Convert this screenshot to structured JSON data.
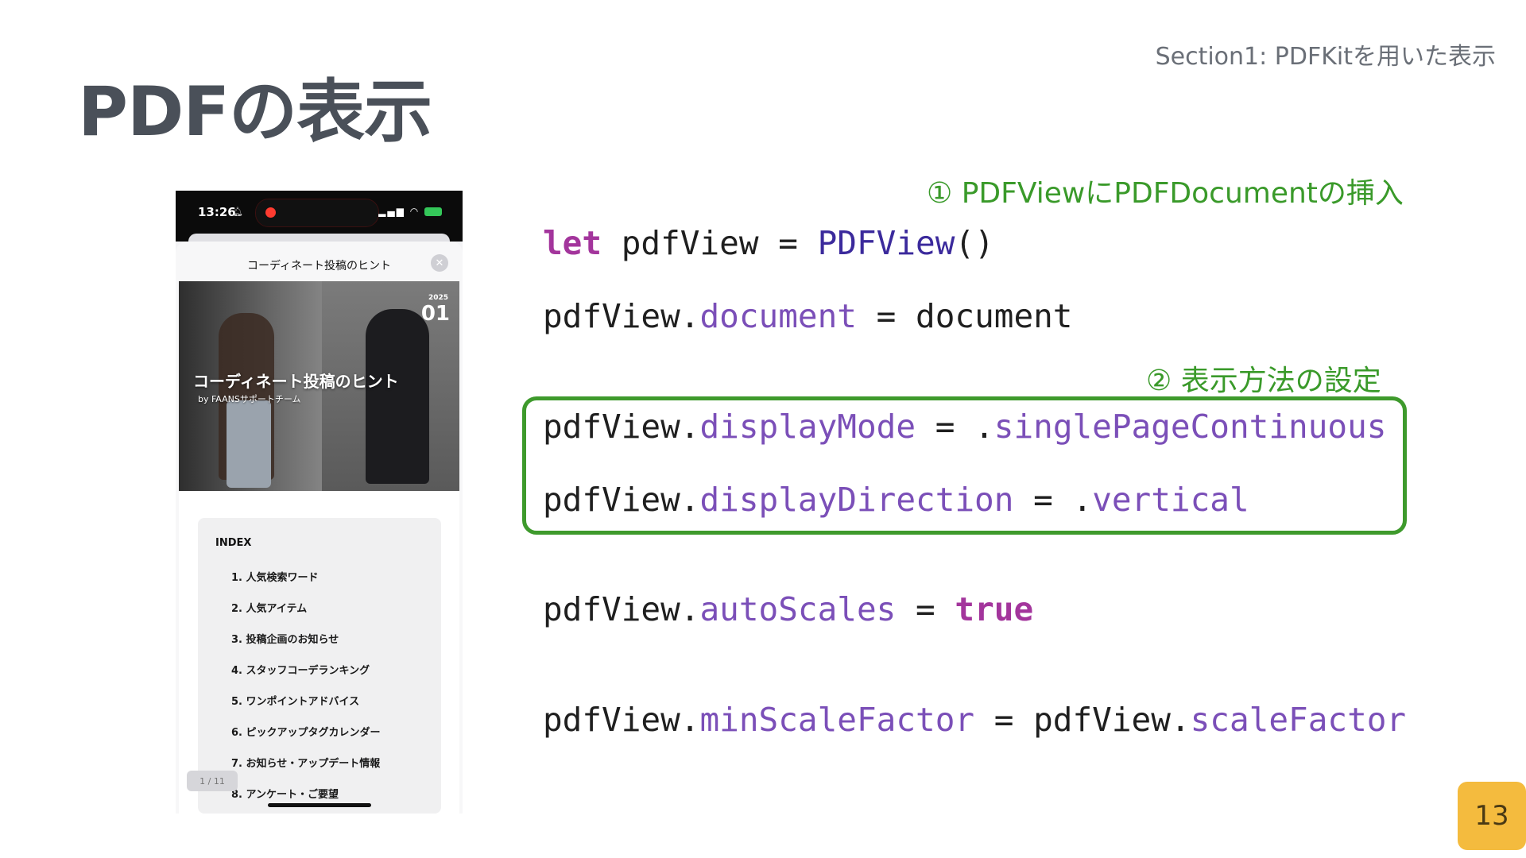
{
  "slide": {
    "title": "PDFの表示",
    "section": "Section1: PDFKitを用いた表示",
    "page_number": "13"
  },
  "phone": {
    "time": "13:26",
    "sheet_title": "コーディネート投稿のヒント",
    "cover": {
      "year": "2025",
      "day": "01",
      "heading": "コーディネート投稿のヒント",
      "subheading": "by FAANSサポートチーム"
    },
    "index_title": "INDEX",
    "index_items": [
      "1. 人気検索ワード",
      "2. 人気アイテム",
      "3. 投稿企画のお知らせ",
      "4. スタッフコーデランキング",
      "5. ワンポイントアドバイス",
      "6. ピックアップタグカレンダー",
      "7. お知らせ・アップデート情報",
      "8. アンケート・ご要望"
    ],
    "page_indicator": "1 / 11"
  },
  "annotations": {
    "a1": "① PDFViewにPDFDocumentの挿入",
    "a2": "② 表示方法の設定"
  },
  "code": {
    "l1": {
      "kw": "let",
      "mid": " pdfView = ",
      "type": "PDFView",
      "end": "()"
    },
    "l2": {
      "obj": "pdfView.",
      "prop": "document",
      "rest": " = document"
    },
    "l3": {
      "obj": "pdfView.",
      "prop": "displayMode",
      "rest": " = .",
      "val": "singlePageContinuous"
    },
    "l4": {
      "obj": "pdfView.",
      "prop": "displayDirection",
      "rest": " = .",
      "val": "vertical"
    },
    "l5": {
      "obj": "pdfView.",
      "prop": "autoScales",
      "rest": " = ",
      "kw": "true"
    },
    "l6": {
      "obj": "pdfView.",
      "prop": "minScaleFactor",
      "rest": " = pdfView.",
      "prop2": "scaleFactor"
    }
  },
  "colors": {
    "annotation": "#3a9a2a",
    "keyword": "#a3359c",
    "property": "#7b4fb8",
    "type": "#3b2a9c",
    "page_badge": "#f4bb3e"
  }
}
